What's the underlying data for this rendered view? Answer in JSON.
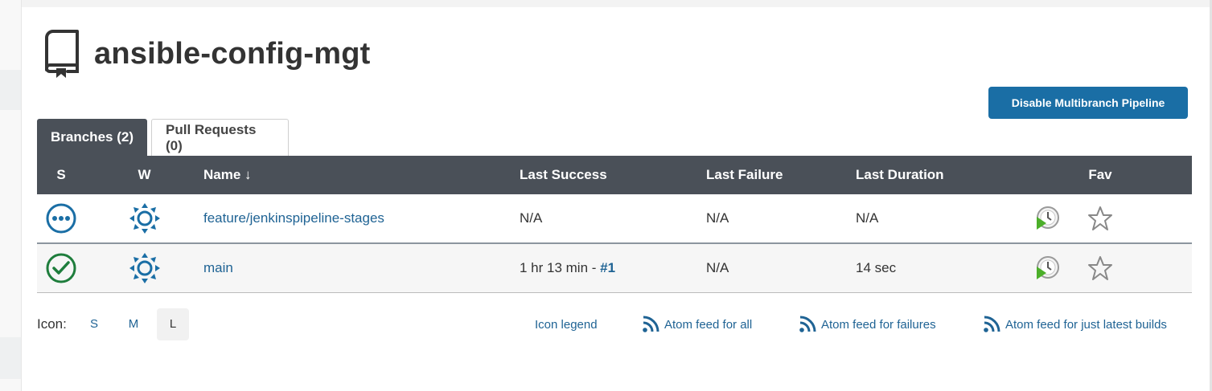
{
  "page": {
    "title": "ansible-config-mgt",
    "disable_button_label": "Disable Multibranch Pipeline"
  },
  "tabs": [
    {
      "label": "Branches (2)",
      "active": true
    },
    {
      "label": "Pull Requests (0)",
      "active": false
    }
  ],
  "table": {
    "columns": [
      "S",
      "W",
      "Name ↓",
      "Last Success",
      "Last Failure",
      "Last Duration",
      "Fav"
    ],
    "rows": [
      {
        "status_icon": "in-progress-icon",
        "weather_icon": "weather-sunny-icon",
        "name": "feature/jenkinspipeline-stages",
        "last_success": "N/A",
        "last_success_build": "",
        "last_failure": "N/A",
        "last_duration": "N/A"
      },
      {
        "status_icon": "success-check-icon",
        "weather_icon": "weather-sunny-icon",
        "name": "main",
        "last_success": "1 hr 13 min - ",
        "last_success_build": "#1",
        "last_failure": "N/A",
        "last_duration": "14 sec"
      }
    ]
  },
  "footer": {
    "icon_label": "Icon:",
    "sizes": [
      "S",
      "M",
      "L"
    ],
    "selected_size": "L",
    "links": {
      "legend": "Icon legend",
      "atom_all": "Atom feed for all",
      "atom_failures": "Atom feed for failures",
      "atom_latest": "Atom feed for just latest builds"
    }
  },
  "colors": {
    "accent": "#1a6ea5",
    "header_bg": "#4a5058",
    "link": "#1f6394",
    "success": "#1e7d3c",
    "in_progress": "#1a6ea5"
  }
}
